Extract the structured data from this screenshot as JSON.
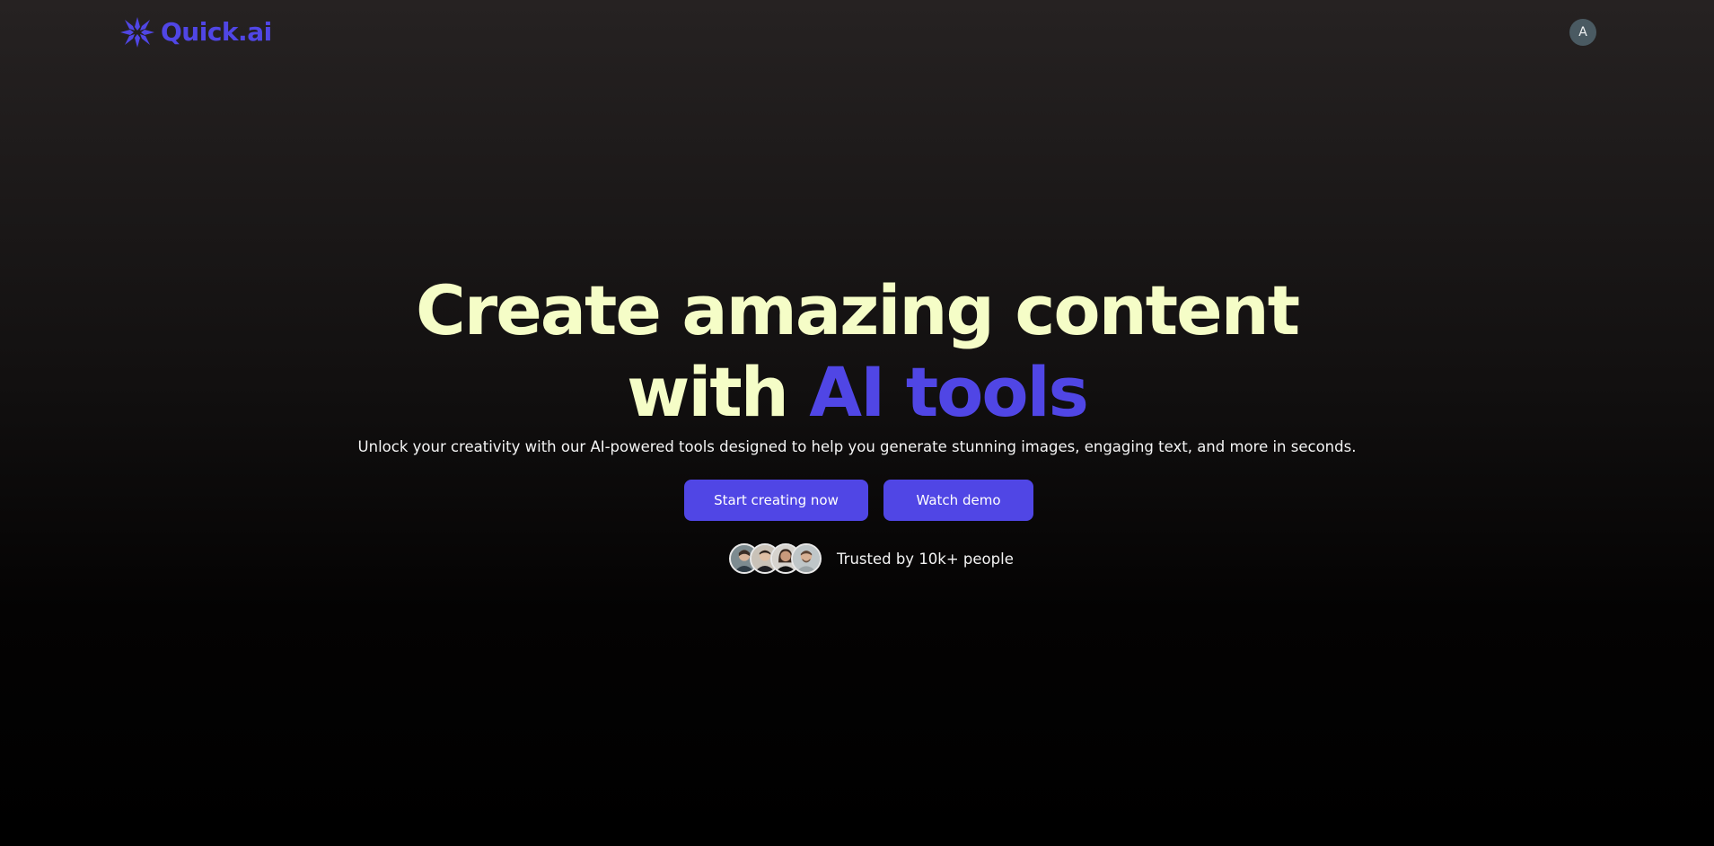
{
  "header": {
    "logo_text": "Quick.ai",
    "logo_icon": "sparkle-star-icon",
    "user_avatar_initial": "A"
  },
  "hero": {
    "title_line1": "Create amazing content",
    "title_line2_prefix": "with ",
    "title_line2_accent": "AI tools",
    "subtitle": "Unlock your creativity with our AI-powered tools designed to help you generate stunning images, engaging text, and more in seconds."
  },
  "actions": {
    "primary_label": "Start creating now",
    "secondary_label": "Watch demo"
  },
  "social_proof": {
    "text": "Trusted by 10k+ people",
    "avatar_count": 4
  },
  "colors": {
    "accent": "#5046e5",
    "heading": "#f5fdc7",
    "background_top": "#262222",
    "background_bottom": "#000000",
    "avatar_bg": "#4a5a62"
  }
}
